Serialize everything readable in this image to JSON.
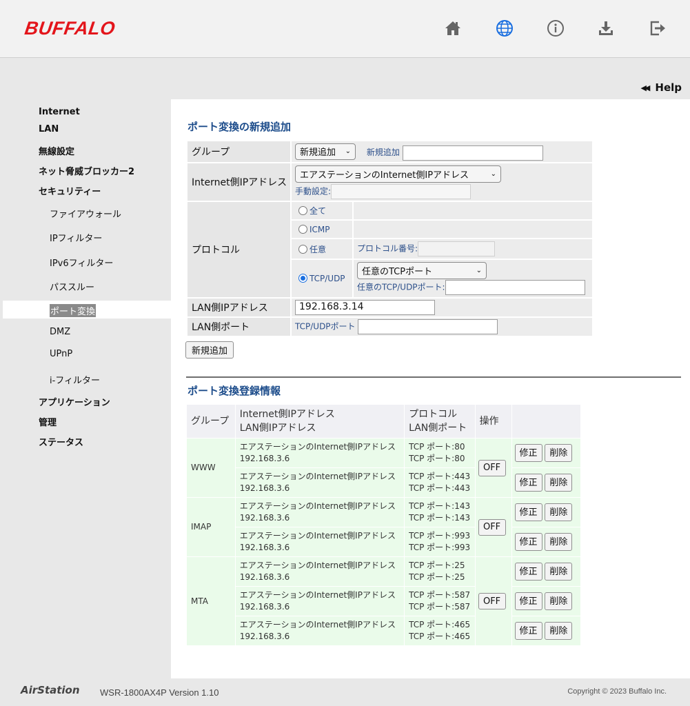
{
  "header": {
    "brand": "BUFFALO",
    "icons": [
      "home-icon",
      "internet-globe-icon",
      "info-icon",
      "download-icon",
      "logout-icon"
    ]
  },
  "help_label": "Help",
  "sidebar": {
    "items": [
      {
        "label": "Internet"
      },
      {
        "label": "LAN"
      },
      {
        "label": "無線設定"
      },
      {
        "label": "ネット脅威ブロッカー2"
      },
      {
        "label": "セキュリティー"
      },
      {
        "label": "ファイアウォール"
      },
      {
        "label": "IPフィルター"
      },
      {
        "label": "IPv6フィルター"
      },
      {
        "label": "パススルー"
      },
      {
        "label": "ポート変換"
      },
      {
        "label": "DMZ"
      },
      {
        "label": "UPnP"
      },
      {
        "label": "i-フィルター"
      },
      {
        "label": "アプリケーション"
      },
      {
        "label": "管理"
      },
      {
        "label": "ステータス"
      }
    ]
  },
  "add_form": {
    "title": "ポート変換の新規追加",
    "group_label": "グループ",
    "group_select": "新規追加",
    "new_group_label": "新規追加",
    "new_group_value": "",
    "wan_ip_label": "Internet側IPアドレス",
    "wan_ip_select": "エアステーションのInternet側IPアドレス",
    "manual_label": "手動設定:",
    "manual_value": "",
    "protocol_label": "プロトコル",
    "proto_all": "全て",
    "proto_icmp": "ICMP",
    "proto_any": "任意",
    "proto_number_label": "プロトコル番号:",
    "proto_number_value": "",
    "proto_tcpudp": "TCP/UDP",
    "tcp_port_select": "任意のTCPポート",
    "tcp_port_label": "任意のTCP/UDPポート:",
    "tcp_port_value": "",
    "lan_ip_label": "LAN側IPアドレス",
    "lan_ip_value": "192.168.3.14",
    "lan_port_label": "LAN側ポート",
    "lan_port_sub": "TCP/UDPポート",
    "lan_port_value": "",
    "add_button": "新規追加"
  },
  "list": {
    "title": "ポート変換登録情報",
    "headers": {
      "group": "グループ",
      "ip_line1": "Internet側IPアドレス",
      "ip_line2": "LAN側IPアドレス",
      "proto_line1": "プロトコル",
      "proto_line2": "LAN側ポート",
      "op": "操作"
    },
    "off_label": "OFF",
    "edit_label": "修正",
    "delete_label": "削除",
    "groups": [
      {
        "name": "WWW",
        "rows": [
          {
            "wan": "エアステーションのInternet側IPアドレス",
            "lan": "192.168.3.6",
            "proto": "TCP ポート:80",
            "port": "TCP ポート:80"
          },
          {
            "wan": "エアステーションのInternet側IPアドレス",
            "lan": "192.168.3.6",
            "proto": "TCP ポート:443",
            "port": "TCP ポート:443"
          }
        ]
      },
      {
        "name": "IMAP",
        "rows": [
          {
            "wan": "エアステーションのInternet側IPアドレス",
            "lan": "192.168.3.6",
            "proto": "TCP ポート:143",
            "port": "TCP ポート:143"
          },
          {
            "wan": "エアステーションのInternet側IPアドレス",
            "lan": "192.168.3.6",
            "proto": "TCP ポート:993",
            "port": "TCP ポート:993"
          }
        ]
      },
      {
        "name": "MTA",
        "rows": [
          {
            "wan": "エアステーションのInternet側IPアドレス",
            "lan": "192.168.3.6",
            "proto": "TCP ポート:25",
            "port": "TCP ポート:25"
          },
          {
            "wan": "エアステーションのInternet側IPアドレス",
            "lan": "192.168.3.6",
            "proto": "TCP ポート:587",
            "port": "TCP ポート:587"
          },
          {
            "wan": "エアステーションのInternet側IPアドレス",
            "lan": "192.168.3.6",
            "proto": "TCP ポート:465",
            "port": "TCP ポート:465"
          }
        ]
      }
    ]
  },
  "footer": {
    "brand": "AirStation",
    "model": "WSR-1800AX4P Version 1.10",
    "copyright": "Copyright © 2023 Buffalo Inc."
  },
  "colors": {
    "brand_red": "#e3151b",
    "title_blue": "#1b4b8a",
    "active_icon_blue": "#1a6fe0",
    "row_green": "#eafbea"
  }
}
